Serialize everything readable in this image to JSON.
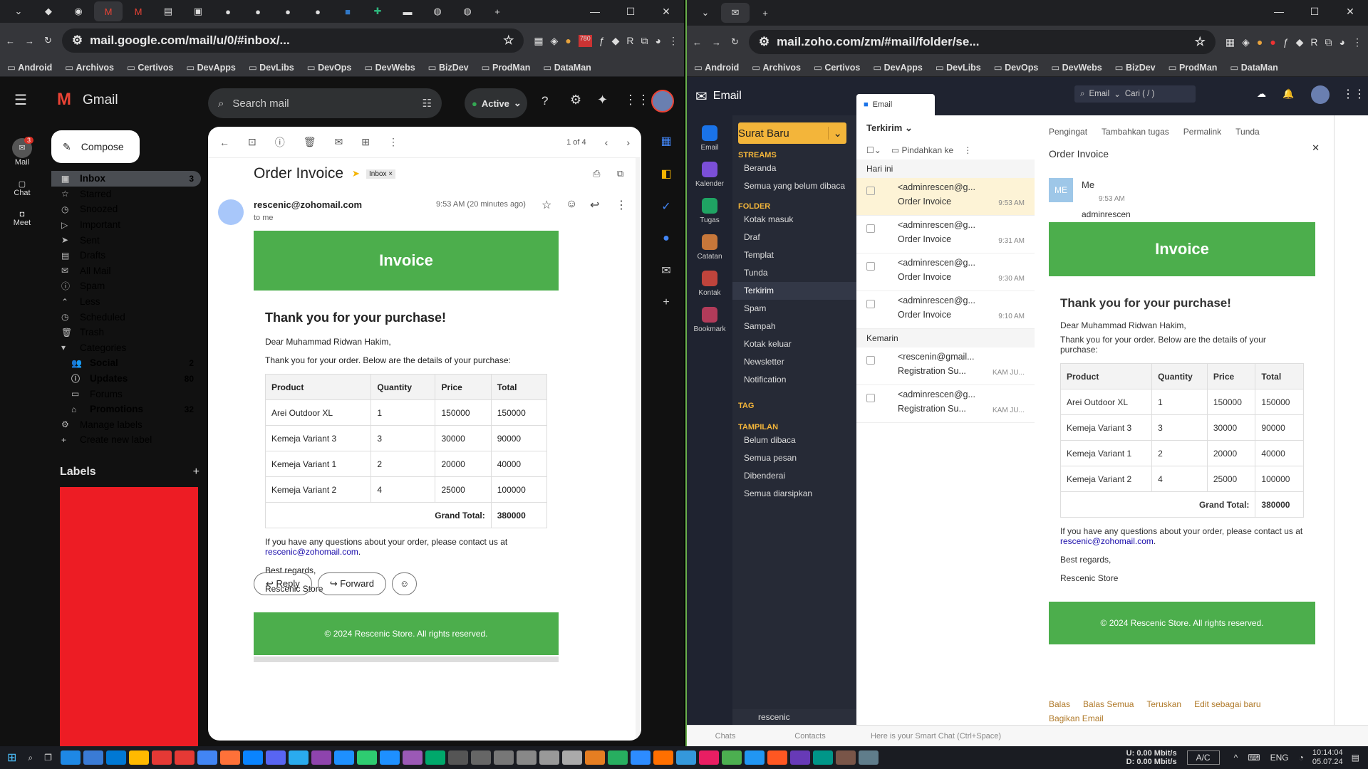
{
  "left_browser": {
    "url": "mail.google.com/mail/u/0/#inbox/...",
    "bookmarks": [
      "Android",
      "Archivos",
      "Certivos",
      "DevApps",
      "DevLibs",
      "DevOps",
      "DevWebs",
      "BizDev",
      "ProdMan",
      "DataMan"
    ],
    "badge": "780"
  },
  "gmail": {
    "brand": "Gmail",
    "search_placeholder": "Search mail",
    "status": "Active",
    "compose": "Compose",
    "rail": [
      "Mail",
      "Chat",
      "Meet"
    ],
    "mail_badge": "3",
    "nav": [
      {
        "label": "Inbox",
        "count": "3"
      },
      {
        "label": "Starred",
        "count": ""
      },
      {
        "label": "Snoozed",
        "count": ""
      },
      {
        "label": "Important",
        "count": ""
      },
      {
        "label": "Sent",
        "count": ""
      },
      {
        "label": "Drafts",
        "count": ""
      },
      {
        "label": "All Mail",
        "count": ""
      },
      {
        "label": "Spam",
        "count": ""
      },
      {
        "label": "Less",
        "count": ""
      },
      {
        "label": "Scheduled",
        "count": ""
      },
      {
        "label": "Trash",
        "count": ""
      },
      {
        "label": "Categories",
        "count": ""
      },
      {
        "label": "Social",
        "count": "2"
      },
      {
        "label": "Updates",
        "count": "80"
      },
      {
        "label": "Forums",
        "count": ""
      },
      {
        "label": "Promotions",
        "count": "32"
      },
      {
        "label": "Manage labels",
        "count": ""
      },
      {
        "label": "Create new label",
        "count": ""
      }
    ],
    "labels_title": "Labels",
    "pager": "1 of 4",
    "subject": "Order Invoice",
    "inbox_chip": "Inbox ×",
    "from": "rescenic@zohomail.com",
    "to": "to me",
    "time": "9:53 AM (20 minutes ago)",
    "reply": "Reply",
    "forward": "Forward"
  },
  "invoice": {
    "header": "Invoice",
    "thanks": "Thank you for your purchase!",
    "dear": "Dear Muhammad Ridwan Hakim,",
    "intro": "Thank you for your order. Below are the details of your purchase:",
    "cols": [
      "Product",
      "Quantity",
      "Price",
      "Total"
    ],
    "rows": [
      [
        "Arei Outdoor XL",
        "1",
        "150000",
        "150000"
      ],
      [
        "Kemeja Variant 3",
        "3",
        "30000",
        "90000"
      ],
      [
        "Kemeja Variant 1",
        "2",
        "20000",
        "40000"
      ],
      [
        "Kemeja Variant 2",
        "4",
        "25000",
        "100000"
      ]
    ],
    "grand_label": "Grand Total:",
    "grand_value": "380000",
    "questions": "If you have any questions about your order, please contact us at",
    "email": "rescenic@zohomail.com",
    "regards": "Best regards,",
    "store": "Rescenic Store",
    "footer": "© 2024 Rescenic Store. All rights reserved."
  },
  "right_browser": {
    "url": "mail.zoho.com/zm/#mail/folder/se...",
    "bookmarks": [
      "Android",
      "Archivos",
      "Certivos",
      "DevApps",
      "DevLibs",
      "DevOps",
      "DevWebs",
      "BizDev",
      "ProdMan",
      "DataMan"
    ]
  },
  "zoho": {
    "brand": "Email",
    "tab": "Email",
    "search_scope": "Email",
    "search_placeholder": "Cari ( / )",
    "rail": [
      "Email",
      "Kalender",
      "Tugas",
      "Catatan",
      "Kontak",
      "Bookmark"
    ],
    "new_mail": "Surat Baru",
    "streams": "STREAMS",
    "stream_items": [
      "Beranda",
      "Semua yang belum dibaca"
    ],
    "folder": "FOLDER",
    "folders": [
      "Kotak masuk",
      "Draf",
      "Templat",
      "Tunda",
      "Terkirim",
      "Spam",
      "Sampah",
      "Kotak keluar",
      "Newsletter",
      "Notification"
    ],
    "tag": "TAG",
    "views": "TAMPILAN",
    "view_items": [
      "Belum dibaca",
      "Semua pesan",
      "Dibenderai",
      "Semua diarsipkan"
    ],
    "user": "rescenic",
    "list_title": "Terkirim",
    "move_to": "Pindahkan ke",
    "today": "Hari ini",
    "yesterday": "Kemarin",
    "mails": [
      {
        "from": "<adminrescen@g...",
        "subject": "Order Invoice",
        "time": "9:53 AM"
      },
      {
        "from": "<adminrescen@g...",
        "subject": "Order Invoice",
        "time": "9:31 AM"
      },
      {
        "from": "<adminrescen@g...",
        "subject": "Order Invoice",
        "time": "9:30 AM"
      },
      {
        "from": "<adminrescen@g...",
        "subject": "Order Invoice",
        "time": "9:10 AM"
      },
      {
        "from": "<rescenin@gmail...",
        "subject": "Registration Su...",
        "time": "KAM JU..."
      },
      {
        "from": "<adminrescen@g...",
        "subject": "Registration Su...",
        "time": "KAM JU..."
      }
    ],
    "actions": [
      "Pengingat",
      "Tambahkan tugas",
      "Permalink",
      "Tunda"
    ],
    "subject": "Order Invoice",
    "sender_initials": "ME",
    "sender": "Me",
    "time": "9:53 AM",
    "recipient": "adminrescen",
    "bottom_actions": [
      "Balas",
      "Balas Semua",
      "Teruskan",
      "Edit sebagai baru",
      "Bagikan Email"
    ],
    "chat_hint": "Here is your Smart Chat (Ctrl+Space)",
    "chats": "Chats",
    "contacts": "Contacts"
  },
  "taskbar": {
    "up": "U:",
    "down": "D:",
    "up_rate": "0.00 Mbit/s",
    "down_rate": "0.00 Mbit/s",
    "ac": "A/C",
    "lang": "ENG",
    "time": "10:14:04",
    "date": "05.07.24"
  }
}
